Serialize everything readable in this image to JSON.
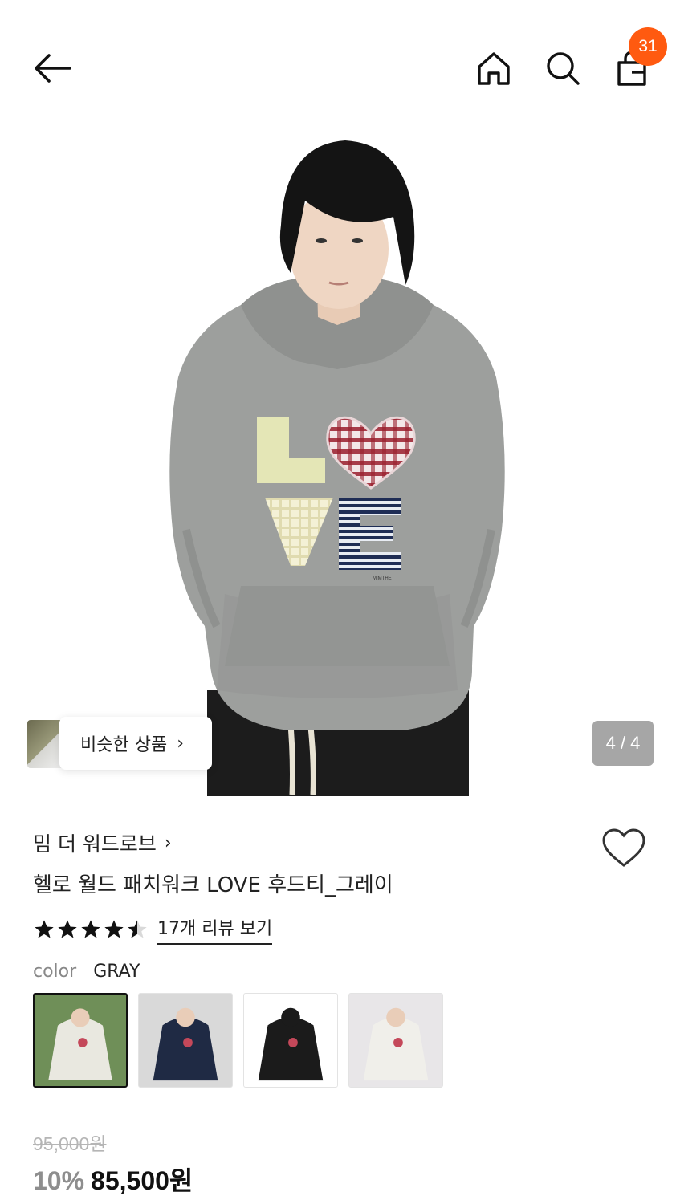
{
  "header": {
    "cart_count": "31",
    "badge_color": "#ff5a10",
    "icons": [
      "arrow-left-icon",
      "home-icon",
      "search-icon",
      "shopping-bag-icon"
    ]
  },
  "hero": {
    "pager": "4 / 4",
    "similar_label": "비슷한 상품",
    "chevron": "›"
  },
  "product": {
    "brand": "밈 더 워드로브",
    "brand_chevron": "›",
    "title": "헬로 월드 패치워크 LOVE 후드티_그레이",
    "rating": 4.5,
    "star_color": "#111111",
    "review_link": "17개 리뷰 보기",
    "color_label": "color",
    "color_value": "GRAY",
    "original_price": "95,000원",
    "discount": "10%",
    "sale_price": "85,500원"
  },
  "swatches": [
    {
      "name": "swatch-1",
      "bg": "#6f8f58",
      "hood": "#e9e8e0",
      "selected": true
    },
    {
      "name": "swatch-2",
      "bg": "#d9d9d9",
      "hood": "#1f2a44",
      "selected": false
    },
    {
      "name": "swatch-3",
      "bg": "#ffffff",
      "hood": "#1b1b1b",
      "selected": false
    },
    {
      "name": "swatch-4",
      "bg": "#e8e6e8",
      "hood": "#f0efea",
      "selected": false
    }
  ]
}
